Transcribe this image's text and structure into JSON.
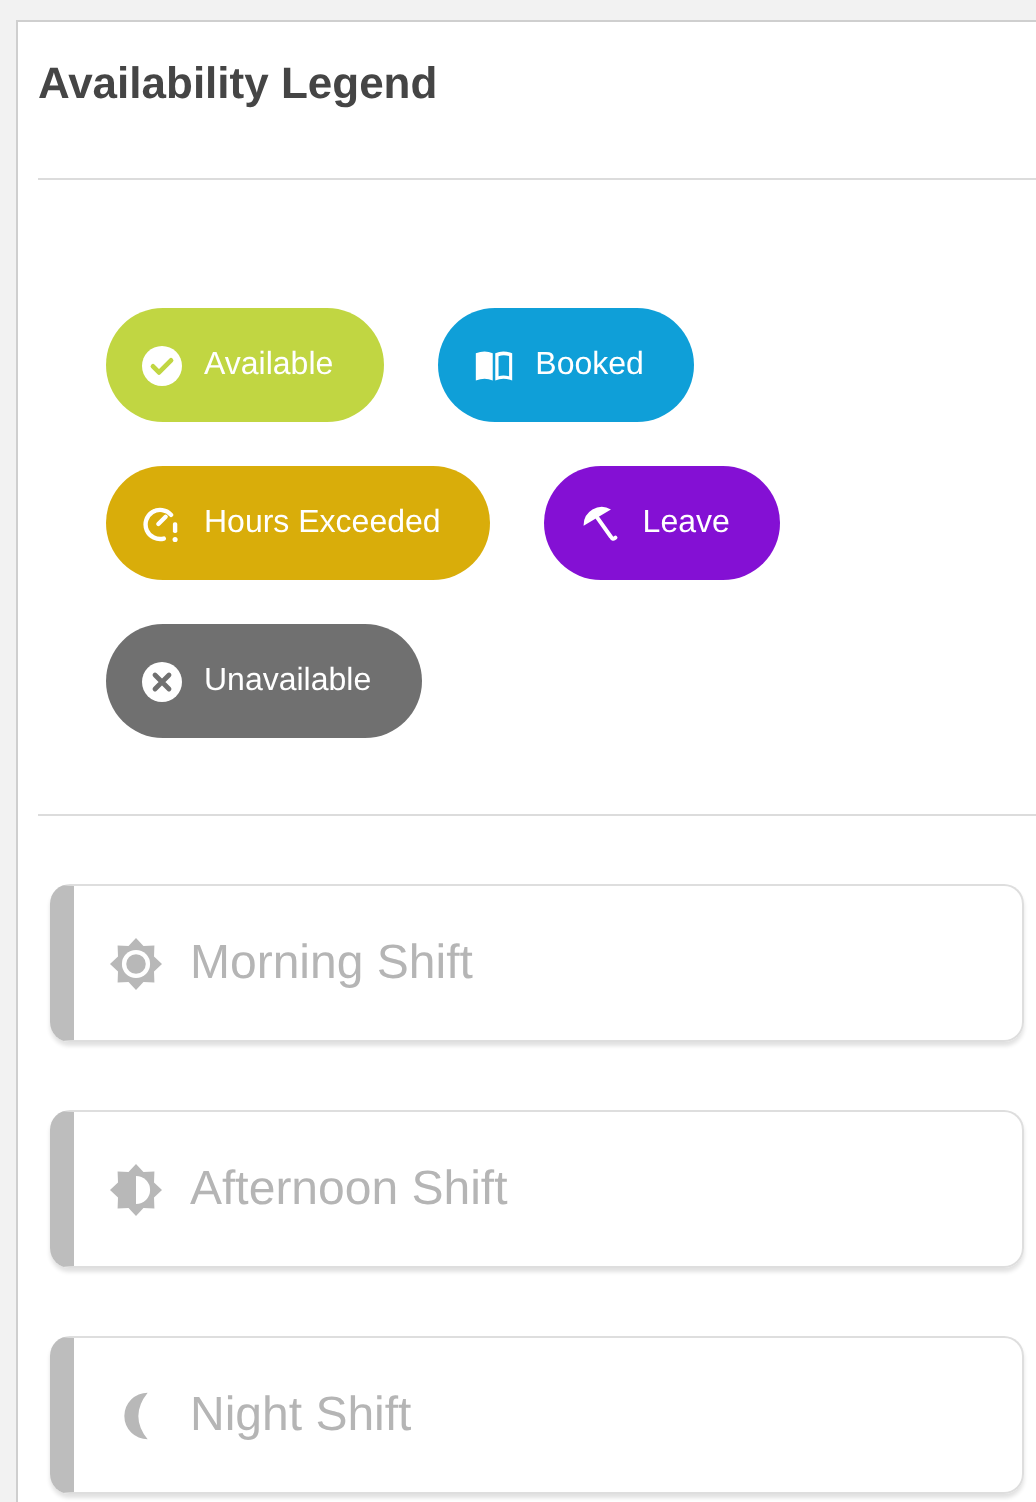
{
  "panel": {
    "title": "Availability Legend"
  },
  "legend": [
    {
      "label": "Available",
      "kind": "check",
      "color": "#c1d642"
    },
    {
      "label": "Booked",
      "kind": "book",
      "color": "#0f9fd8"
    },
    {
      "label": "Hours Exceeded",
      "kind": "clock",
      "color": "#d9ad0a"
    },
    {
      "label": "Leave",
      "kind": "umbrella",
      "color": "#8410d4"
    },
    {
      "label": "Unavailable",
      "kind": "cross",
      "color": "#707070"
    }
  ],
  "shifts": [
    {
      "label": "Morning Shift",
      "kind": "sun"
    },
    {
      "label": "Afternoon Shift",
      "kind": "half-sun"
    },
    {
      "label": "Night Shift",
      "kind": "moon"
    }
  ]
}
